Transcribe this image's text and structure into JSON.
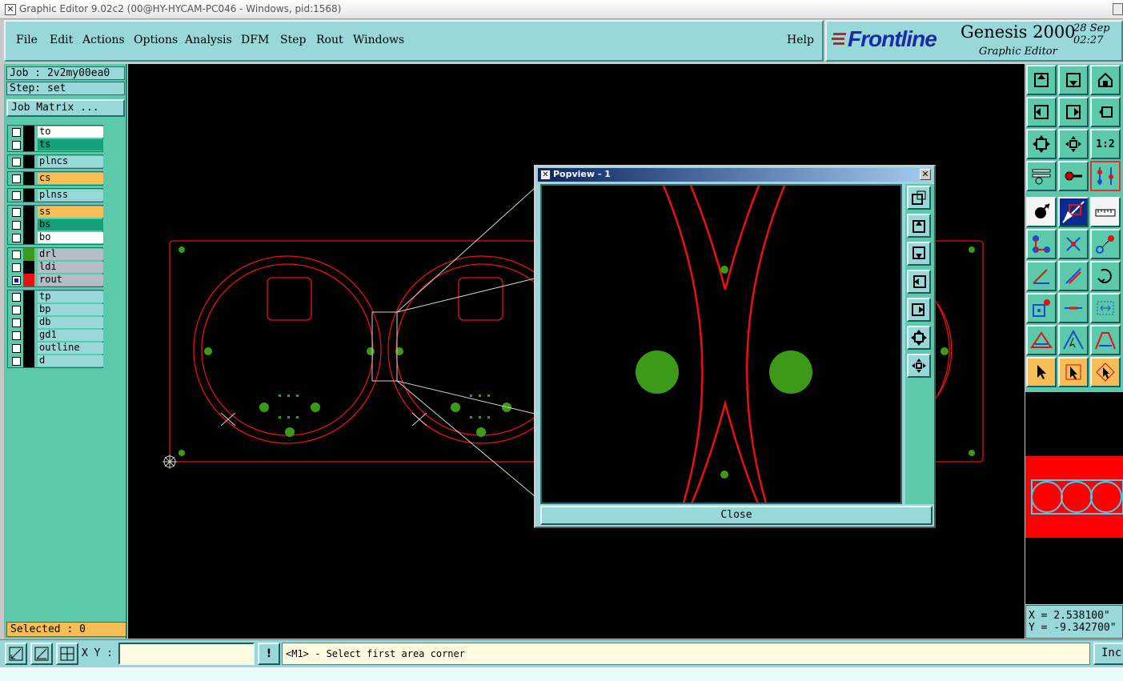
{
  "window": {
    "title": "Graphic Editor 9.02c2 (00@HY-HYCAM-PC046 - Windows, pid:1568)"
  },
  "menu": [
    "File",
    "Edit",
    "Actions",
    "Options",
    "Analysis",
    "DFM",
    "Step",
    "Rout",
    "Windows"
  ],
  "help": "Help",
  "brand": {
    "logo": "Frontline",
    "product": "Genesis 2000",
    "subtitle": "Graphic Editor",
    "date": "28 Sep",
    "time": "02:27"
  },
  "job": {
    "job_label": "Job : 2v2my00ea0",
    "step_label": "Step: set",
    "matrix_button": "Job Matrix ..."
  },
  "layers": [
    [
      {
        "name": "to",
        "color": "#ffffff"
      },
      {
        "name": "ts",
        "color": "#14a07a"
      }
    ],
    [
      {
        "name": "plncs",
        "color": "#99d8d8"
      }
    ],
    [
      {
        "name": "cs",
        "color": "#f7be55"
      }
    ],
    [
      {
        "name": "plnss",
        "color": "#99d8d8"
      }
    ],
    [
      {
        "name": "ss",
        "color": "#f7be55"
      },
      {
        "name": "bs",
        "color": "#14a07a"
      },
      {
        "name": "bo",
        "color": "#ffffff"
      }
    ],
    [
      {
        "name": "drl",
        "color": "#b4bcc8",
        "swatch": "#3c9a18"
      },
      {
        "name": "ldi",
        "color": "#b4bcc8"
      },
      {
        "name": "rout",
        "color": "#b4bcc8",
        "swatch": "#e81010",
        "checked": true
      }
    ],
    [
      {
        "name": "tp",
        "color": "#99d8d8"
      },
      {
        "name": "bp",
        "color": "#99d8d8"
      },
      {
        "name": "db",
        "color": "#99d8d8"
      },
      {
        "name": "gd1",
        "color": "#99d8d8"
      },
      {
        "name": "outline",
        "color": "#99d8d8"
      },
      {
        "name": "d",
        "color": "#99d8d8"
      }
    ]
  ],
  "selected": "Selected : 0",
  "popview": {
    "title": "Popview - 1",
    "close": "Close"
  },
  "coords": {
    "x": "X = 2.538100\"",
    "y": "Y = -9.342700\""
  },
  "bottom": {
    "xy_label": "X Y :",
    "xy_value": "",
    "prompt": "<M1> - Select first area corner",
    "inc": "Inc"
  },
  "colors": {
    "panel": "#99d8d8",
    "layer_panel": "#5ccaaa",
    "rout": "#e81010",
    "drill": "#3c9a18",
    "selected": "#f7be55"
  }
}
